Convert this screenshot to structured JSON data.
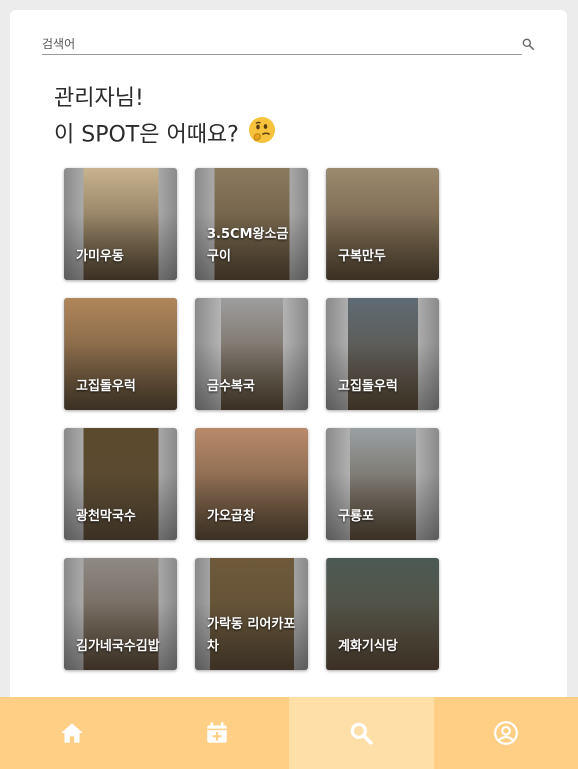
{
  "search": {
    "placeholder": "검색어",
    "icon": "search-icon"
  },
  "greeting": {
    "line1": "관리자님!",
    "line2": "이 SPOT은 어때요?",
    "emoji": "thinking-face-icon"
  },
  "spots": [
    {
      "name": "가미우동",
      "photo_color": "#c7b38e"
    },
    {
      "name": "3.5CM왕소금구이",
      "photo_color": "#8b7a5e"
    },
    {
      "name": "구복만두",
      "photo_color": "#9c8a6e"
    },
    {
      "name": "고집돌우럭",
      "photo_color": "#b0865a"
    },
    {
      "name": "금수복국",
      "photo_color": "#9e9e9e"
    },
    {
      "name": "고집돌우럭",
      "photo_color": "#5f6b74"
    },
    {
      "name": "광천막국수",
      "photo_color": "#5b4a2c"
    },
    {
      "name": "가오곱창",
      "photo_color": "#b98a6a"
    },
    {
      "name": "구룡포",
      "photo_color": "#9aa0a3"
    },
    {
      "name": "김가네국수김밥",
      "photo_color": "#8f8a86"
    },
    {
      "name": "가락동 리어카포차",
      "photo_color": "#6e5a3a"
    },
    {
      "name": "계화기식당",
      "photo_color": "#4c5a55"
    }
  ],
  "nav": {
    "items": [
      {
        "icon": "home-icon",
        "active": false
      },
      {
        "icon": "calendar-add-icon",
        "active": false
      },
      {
        "icon": "search-icon",
        "active": true
      },
      {
        "icon": "account-circle-icon",
        "active": false
      }
    ],
    "color": "#ffcf85",
    "active_color": "#ffdfa8"
  }
}
